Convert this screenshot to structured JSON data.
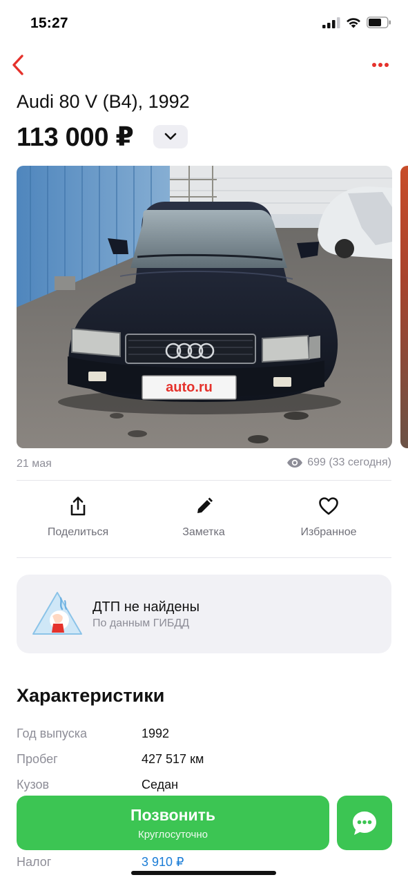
{
  "status_bar": {
    "time": "15:27"
  },
  "listing": {
    "title": "Audi 80 V (B4), 1992",
    "price": "113 000 ₽",
    "plate_text": "auto.ru",
    "date": "21 мая",
    "views": "699 (33 сегодня)"
  },
  "actions": [
    {
      "label": "Поделиться",
      "icon": "share-icon"
    },
    {
      "label": "Заметка",
      "icon": "pencil-icon"
    },
    {
      "label": "Избранное",
      "icon": "heart-icon"
    }
  ],
  "dtp": {
    "title": "ДТП не найдены",
    "subtitle": "По данным ГИБДД"
  },
  "specs": {
    "heading": "Характеристики",
    "rows": [
      {
        "key": "Год выпуска",
        "value": "1992"
      },
      {
        "key": "Пробег",
        "value": "427 517 км"
      },
      {
        "key": "Кузов",
        "value": "Седан"
      },
      {
        "key": "Налог",
        "value": "3 910 ₽"
      }
    ]
  },
  "bottom_bar": {
    "call_label": "Позвонить",
    "call_sub": "Круглосуточно"
  },
  "colors": {
    "accent_red": "#e5322c",
    "call_green": "#3cc553",
    "link_blue": "#1a7cd6"
  }
}
